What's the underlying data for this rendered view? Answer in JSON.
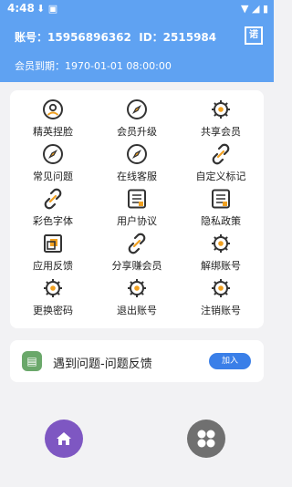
{
  "status_bar": {
    "time": "4:48"
  },
  "header": {
    "account_label": "账号：",
    "account_number": "15956896362",
    "id_label": "ID：",
    "id_value": "2515984",
    "qr_button": "诺",
    "expire_label": "会员到期：",
    "expire_date": "1970-01-01 08:00:00"
  },
  "menu": {
    "items": [
      {
        "label": "精英捏脸",
        "icon": "face-icon"
      },
      {
        "label": "会员升级",
        "icon": "compass-icon"
      },
      {
        "label": "共享会员",
        "icon": "gear-icon"
      },
      {
        "label": "常见问题",
        "icon": "compass-icon"
      },
      {
        "label": "在线客服",
        "icon": "compass-icon"
      },
      {
        "label": "自定义标记",
        "icon": "link-icon"
      },
      {
        "label": "彩色字体",
        "icon": "link-icon"
      },
      {
        "label": "用户协议",
        "icon": "document-icon"
      },
      {
        "label": "隐私政策",
        "icon": "document-icon"
      },
      {
        "label": "应用反馈",
        "icon": "feedback-icon"
      },
      {
        "label": "分享赚会员",
        "icon": "link-icon"
      },
      {
        "label": "解绑账号",
        "icon": "gear-icon"
      },
      {
        "label": "更换密码",
        "icon": "gear-icon"
      },
      {
        "label": "退出账号",
        "icon": "gear-icon"
      },
      {
        "label": "注销账号",
        "icon": "gear-icon"
      }
    ]
  },
  "feedback": {
    "text": "遇到问题-问题反馈",
    "button": "加入"
  },
  "colors": {
    "header_bg": "#5fa2f2",
    "icon_stroke": "#333333",
    "icon_accent": "#f0a020",
    "join_button": "#3a7fe8",
    "home_tab": "#7e57c2",
    "apps_tab": "#707070"
  }
}
